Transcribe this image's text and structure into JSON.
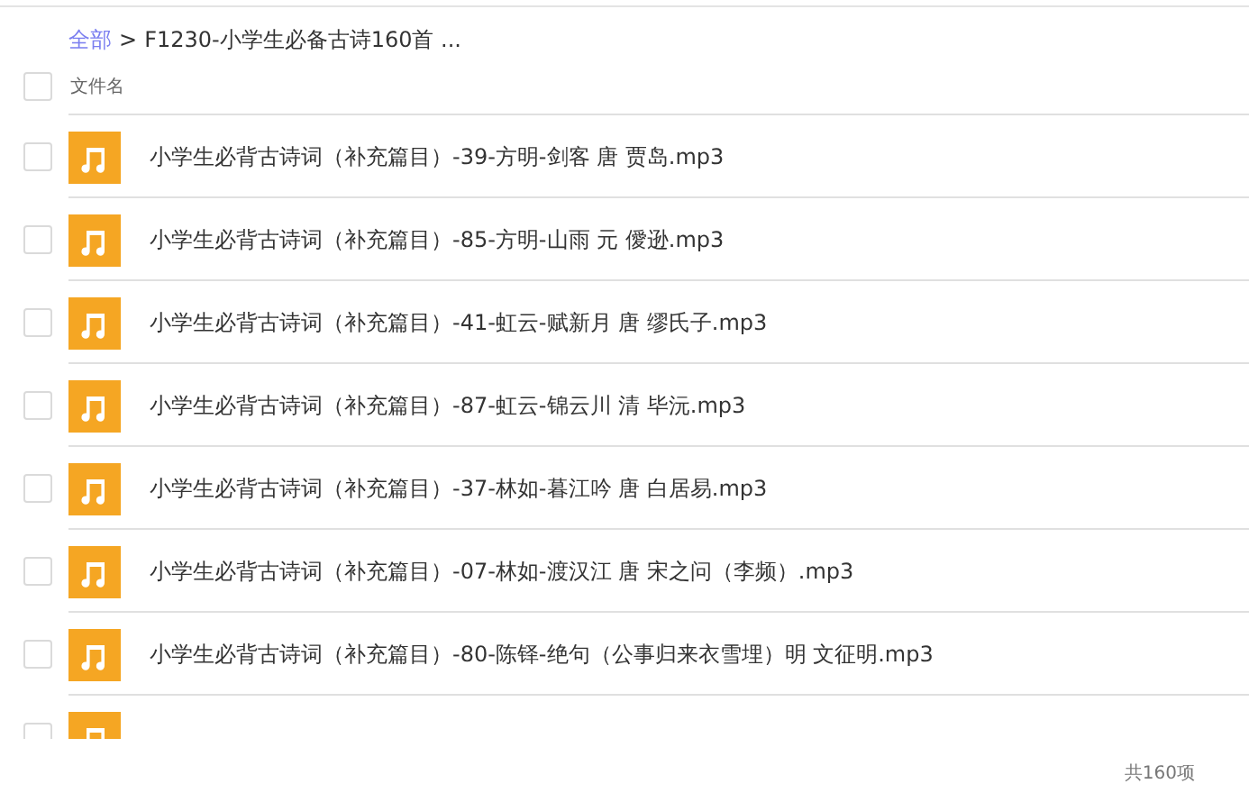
{
  "breadcrumb": {
    "root": "全部",
    "separator": ">",
    "current": "F1230-小学生必备古诗160首 ..."
  },
  "header": {
    "checked": false,
    "column": "文件名"
  },
  "files": [
    {
      "name": "小学生必背古诗词（补充篇目）-39-方明-剑客 唐 贾岛.mp3",
      "checked": false
    },
    {
      "name": "小学生必背古诗词（补充篇目）-85-方明-山雨 元 僾逊.mp3",
      "checked": false
    },
    {
      "name": "小学生必背古诗词（补充篇目）-41-虹云-赋新月 唐 缪氏子.mp3",
      "checked": false
    },
    {
      "name": "小学生必背古诗词（补充篇目）-87-虹云-锦云川 清 毕沅.mp3",
      "checked": false
    },
    {
      "name": "小学生必背古诗词（补充篇目）-37-林如-暮江吟 唐 白居易.mp3",
      "checked": false
    },
    {
      "name": "小学生必背古诗词（补充篇目）-07-林如-渡汉江 唐 宋之问（李频）.mp3",
      "checked": false
    },
    {
      "name": "小学生必背古诗词（补充篇目）-80-陈铎-绝句（公事归来衣雪埋）明 文征明.mp3",
      "checked": false
    },
    {
      "checked": false
    }
  ],
  "footer": {
    "count": "共160项"
  }
}
